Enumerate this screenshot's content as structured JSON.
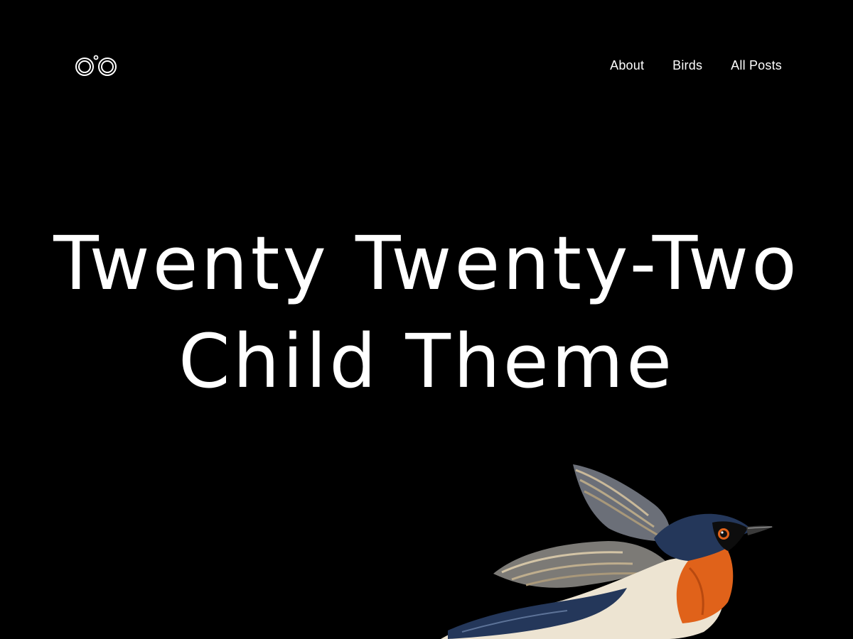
{
  "site": {
    "logo_icon": "binoculars-icon"
  },
  "nav": {
    "items": [
      {
        "label": "About"
      },
      {
        "label": "Birds"
      },
      {
        "label": "All Posts"
      }
    ]
  },
  "hero": {
    "title": "Twenty Twenty-Two Child Theme",
    "illustration": "swallow-bird-illustration"
  },
  "colors": {
    "background": "#000000",
    "text": "#ffffff",
    "bird_throat": "#e0621a",
    "bird_back": "#24375a"
  }
}
